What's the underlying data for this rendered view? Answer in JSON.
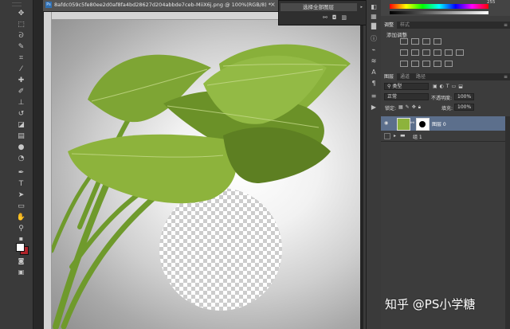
{
  "document": {
    "ps_badge": "Ps",
    "tab_title": "8afdc059c5fe80ee2d0af8fa4bd28627d204abbde7ceb-MiiX6j.png @ 100%(RGB/8) *",
    "close_glyph": "×"
  },
  "context_menu": {
    "item_label": "选择全部图层",
    "arrow_glyph": "▸",
    "icons": [
      "link-icon",
      "camera-icon",
      "trash-icon"
    ]
  },
  "color_panel": {
    "value_readout": "255"
  },
  "adjustments": {
    "tabs": [
      "调整",
      "样式"
    ],
    "add_label": "添加调整"
  },
  "layers_panel": {
    "tabs": [
      "图层",
      "通道",
      "路径"
    ],
    "kind_filter": "类型",
    "blend_mode": "正常",
    "opacity_label": "不透明度:",
    "opacity_value": "100%",
    "lock_label": "锁定:",
    "fill_label": "填充:",
    "fill_value": "100%",
    "layers": [
      {
        "name": "图层 0",
        "selected": true,
        "visible": true,
        "type": "pixel"
      },
      {
        "name": "组 1",
        "selected": false,
        "visible": false,
        "type": "group"
      }
    ]
  },
  "watermark": "知乎 @PS小学糖",
  "tool_icons": [
    "move-icon",
    "marquee-icon",
    "lasso-icon",
    "quick-select-icon",
    "crop-icon",
    "eyedropper-icon",
    "healing-icon",
    "brush-icon",
    "stamp-icon",
    "history-brush-icon",
    "eraser-icon",
    "gradient-icon",
    "blur-icon",
    "dodge-icon",
    "pen-icon",
    "type-icon",
    "path-select-icon",
    "shape-icon",
    "hand-icon",
    "zoom-icon"
  ],
  "colors": {
    "selected_layer": "#5c6f8c",
    "leaf_dark": "#5d7f22",
    "leaf_light": "#8db33c",
    "foreground_swatch": "#ffffff",
    "background_swatch": "#b0232a"
  }
}
